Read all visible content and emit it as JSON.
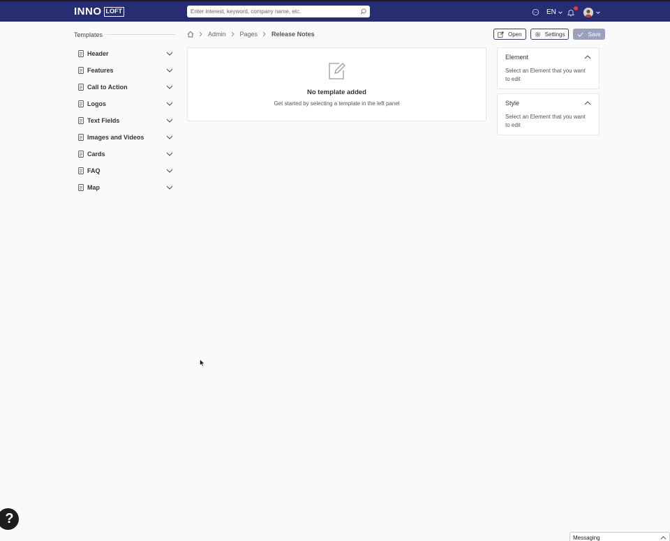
{
  "topbar": {
    "logo_main": "INNO",
    "logo_box": "LOFT",
    "search_placeholder": "Enter interest, keyword, company name, etc.",
    "language": "EN",
    "colors": {
      "nav_bg": "#262d73",
      "notification": "#e03a3a"
    }
  },
  "sidebar": {
    "title": "Templates",
    "items": [
      {
        "label": "Header"
      },
      {
        "label": "Features"
      },
      {
        "label": "Call to Action"
      },
      {
        "label": "Logos"
      },
      {
        "label": "Text Fields"
      },
      {
        "label": "Images and Videos"
      },
      {
        "label": "Cards"
      },
      {
        "label": "FAQ"
      },
      {
        "label": "Map"
      }
    ]
  },
  "breadcrumb": {
    "items": [
      "Admin",
      "Pages"
    ],
    "current": "Release Notes"
  },
  "actions": {
    "open_label": "Open",
    "settings_label": "Settings",
    "save_label": "Save"
  },
  "main": {
    "empty_title": "No template added",
    "empty_subtitle": "Get started by selecting a template in the left panel"
  },
  "right_panels": {
    "element": {
      "title": "Element",
      "body": "Select an Element that you want to edit"
    },
    "style": {
      "title": "Style",
      "body": "Select an Element that you want to edit"
    }
  },
  "help_button": {
    "label": "?"
  },
  "messaging": {
    "label": "Messaging"
  }
}
